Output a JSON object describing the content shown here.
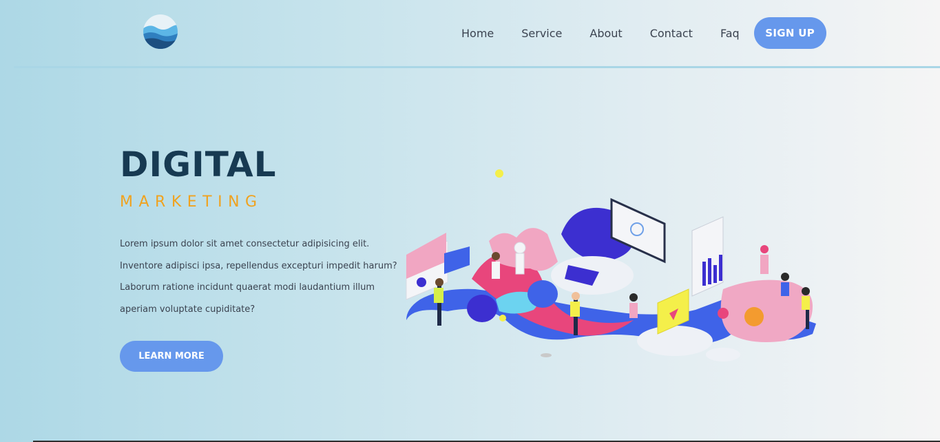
{
  "header": {
    "logo_icon": "wave-logo-icon",
    "nav": [
      {
        "label": "Home"
      },
      {
        "label": "Service"
      },
      {
        "label": "About"
      },
      {
        "label": "Contact"
      },
      {
        "label": "Faq"
      }
    ],
    "signup_label": "SIGN UP"
  },
  "hero": {
    "title": "DIGITAL",
    "subtitle": "MARKETING",
    "paragraph": "Lorem ipsum dolor sit amet consectetur adipisicing elit. Inventore adipisci ipsa, repellendus excepturi impedit harum? Laborum ratione incidunt quaerat modi laudantium illum aperiam voluptate cupiditate?",
    "button_label": "LEARN MORE",
    "illustration_icon": "isometric-marketing-illustration"
  },
  "colors": {
    "accent": "#6698ec",
    "title": "#173a52",
    "subtitle": "#f0a21e",
    "text": "#3b4350"
  }
}
